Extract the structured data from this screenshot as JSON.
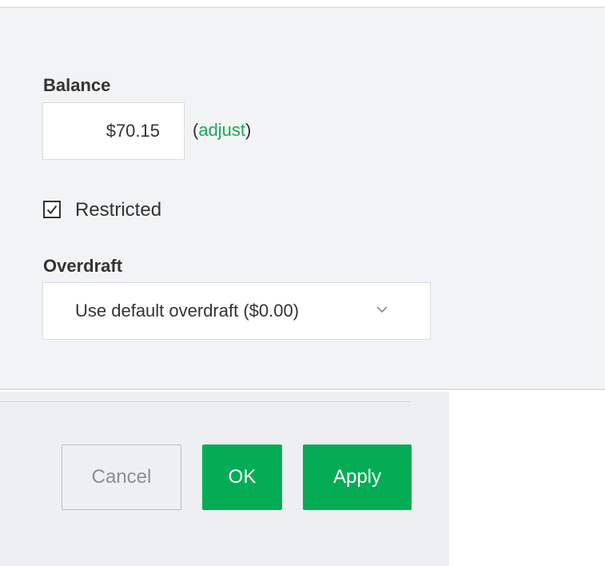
{
  "balance": {
    "label": "Balance",
    "value": "$70.15",
    "adjust_open": "(",
    "adjust_link": "adjust",
    "adjust_close": ")"
  },
  "restricted": {
    "label": "Restricted",
    "checked": true
  },
  "overdraft": {
    "label": "Overdraft",
    "selected": "Use default overdraft ($0.00)"
  },
  "buttons": {
    "cancel": "Cancel",
    "ok": "OK",
    "apply": "Apply"
  },
  "colors": {
    "accent": "#04ad55",
    "link": "#17a85a"
  },
  "icons": {
    "checkbox": "checkmark-icon",
    "dropdown": "chevron-down-icon"
  }
}
